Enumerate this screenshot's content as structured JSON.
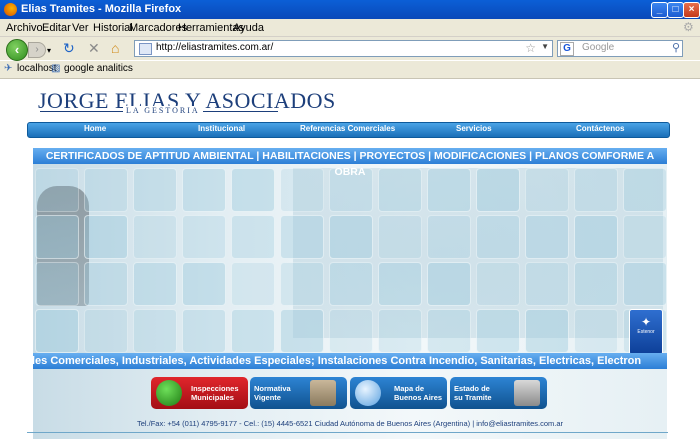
{
  "window": {
    "title": "Elias Tramites - Mozilla Firefox",
    "buttons": {
      "minimize": "_",
      "maximize": "□",
      "close": "×"
    }
  },
  "menu": [
    "Archivo",
    "Editar",
    "Ver",
    "Historial",
    "Marcadores",
    "Herramientas",
    "Ayuda"
  ],
  "navbar": {
    "url": "http://eliastramites.com.ar/",
    "search_placeholder": "Google"
  },
  "bookmarks": [
    "localhost",
    "google analitics"
  ],
  "site": {
    "logo": "JORGE ELIAS Y ASOCIADOS",
    "logo_sub": "LA GESTORIA",
    "nav": [
      "Home",
      "Institucional",
      "Referencias Comerciales",
      "Servicios",
      "Contáctenos"
    ],
    "banner_title": "CERTIFICADOS DE APTITUD AMBIENTAL | HABILITACIONES | PROYECTOS | MODIFICACIONES | PLANOS COMFORME A OBRA",
    "ticker": "les Comerciales, Industriales,  Actividades Especiales; Instalaciones Contra Incendio, Sanitarias, Electricas, Electron",
    "badge_label": "Estenor",
    "quick_buttons": [
      {
        "line1": "Inspecciones",
        "line2": "Municipales",
        "color": "#c8141b"
      },
      {
        "line1": "Normativa",
        "line2": "Vigente",
        "color": "#1b6fbe"
      },
      {
        "line1": "Mapa de",
        "line2": "Buenos Aires",
        "color": "#1b6fbe"
      },
      {
        "line1": "Estado de",
        "line2": "su Tramite",
        "color": "#1b6fbe"
      }
    ],
    "footer": "Tel./Fax: +54 (011) 4795-9177 - Cel.: (15) 4445-6521 Ciudad Autónoma de Buenos Aires (Argentina) | info@eliastramites.com.ar"
  },
  "colors": {
    "titlebar": "#0b5fd6",
    "brand_navy": "#1d3f7b",
    "nav_blue": "#1a6fb8",
    "accent_red": "#c8141b"
  }
}
